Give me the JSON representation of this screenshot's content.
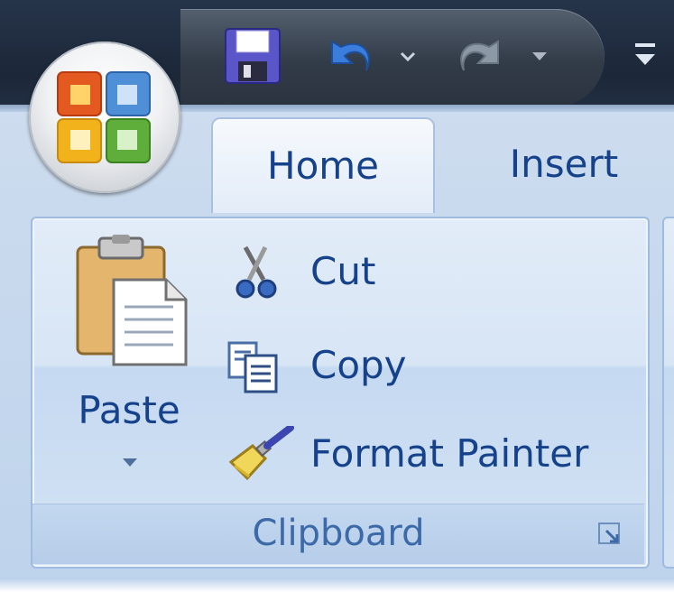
{
  "quick_access": {
    "items": [
      {
        "name": "save-icon"
      },
      {
        "name": "undo-icon"
      },
      {
        "name": "redo-icon"
      },
      {
        "name": "customize-qat-icon"
      }
    ]
  },
  "tabs": [
    {
      "label": "Home",
      "active": true
    },
    {
      "label": "Insert",
      "active": false
    }
  ],
  "clipboard_group": {
    "label": "Clipboard",
    "paste_label": "Paste",
    "commands": [
      {
        "label": "Cut",
        "icon": "scissors-icon"
      },
      {
        "label": "Copy",
        "icon": "copy-icon"
      },
      {
        "label": "Format Painter",
        "icon": "format-painter-icon"
      }
    ]
  },
  "colors": {
    "tab_text": "#15428b",
    "group_label": "#3c6aa8",
    "titlebar": "#1f2a3c",
    "ribbon": "#cddcee"
  }
}
